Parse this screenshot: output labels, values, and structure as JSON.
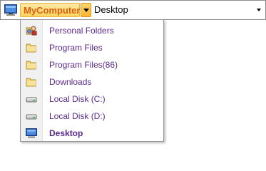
{
  "breadcrumb": {
    "root_label": "MyComputer",
    "current_label": "Desktop"
  },
  "menu": {
    "items": [
      {
        "label": "Personal Folders",
        "icon": "personal-folders-icon"
      },
      {
        "label": "Program Files",
        "icon": "folder-icon"
      },
      {
        "label": "Program Files(86)",
        "icon": "folder-icon"
      },
      {
        "label": "Downloads",
        "icon": "folder-icon"
      },
      {
        "label": "Local Disk (C:)",
        "icon": "drive-icon"
      },
      {
        "label": "Local Disk (D:)",
        "icon": "drive-icon"
      },
      {
        "label": "Desktop",
        "icon": "desktop-icon",
        "selected": true
      }
    ]
  },
  "colors": {
    "root_crumb_text": "#d9600c",
    "root_crumb_bg": "#ffd360",
    "menu_text": "#5b2b8c",
    "gutter": "#f1f1f1"
  }
}
